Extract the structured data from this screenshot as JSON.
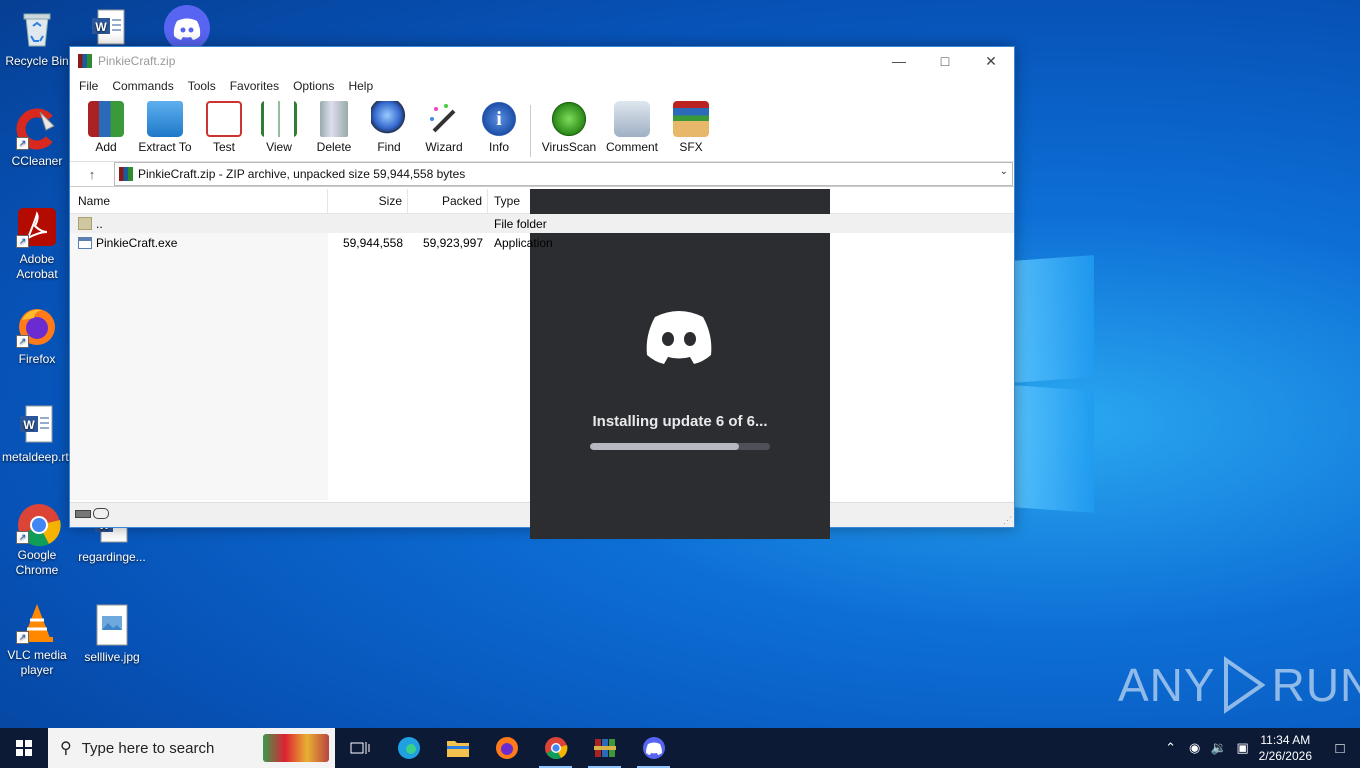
{
  "desktop": {
    "icons": [
      {
        "label": "Recycle Bin"
      },
      {
        "label": "CCleaner"
      },
      {
        "label": "Adobe Acrobat"
      },
      {
        "label": "Firefox"
      },
      {
        "label": "metaldeep.rtf"
      },
      {
        "label": "Google Chrome"
      },
      {
        "label": "VLC media player"
      },
      {
        "label": "regardinge..."
      },
      {
        "label": "selllive.jpg"
      }
    ]
  },
  "winrar": {
    "title": "PinkieCraft.zip",
    "menu": [
      "File",
      "Commands",
      "Tools",
      "Favorites",
      "Options",
      "Help"
    ],
    "toolbar": [
      "Add",
      "Extract To",
      "Test",
      "View",
      "Delete",
      "Find",
      "Wizard",
      "Info",
      "VirusScan",
      "Comment",
      "SFX"
    ],
    "address": "PinkieCraft.zip - ZIP archive, unpacked size 59,944,558 bytes",
    "columns": {
      "name": "Name",
      "size": "Size",
      "packed": "Packed",
      "type": "Type"
    },
    "rows": [
      {
        "name": "..",
        "size": "",
        "packed": "",
        "type": "File folder"
      },
      {
        "name": "PinkieCraft.exe",
        "size": "59,944,558",
        "packed": "59,923,997",
        "type": "Application"
      }
    ]
  },
  "discord_updater": {
    "message": "Installing update 6 of 6...",
    "progress": 0.83
  },
  "watermark": {
    "left": "ANY",
    "right": "RUN"
  },
  "taskbar": {
    "search_placeholder": "Type here to search",
    "time": "11:34 AM",
    "date": "2/26/2026"
  },
  "colors": {
    "desktop": "#0d6fd6",
    "taskbar": "#0c1a36",
    "discord_bg": "#2b2d31"
  }
}
